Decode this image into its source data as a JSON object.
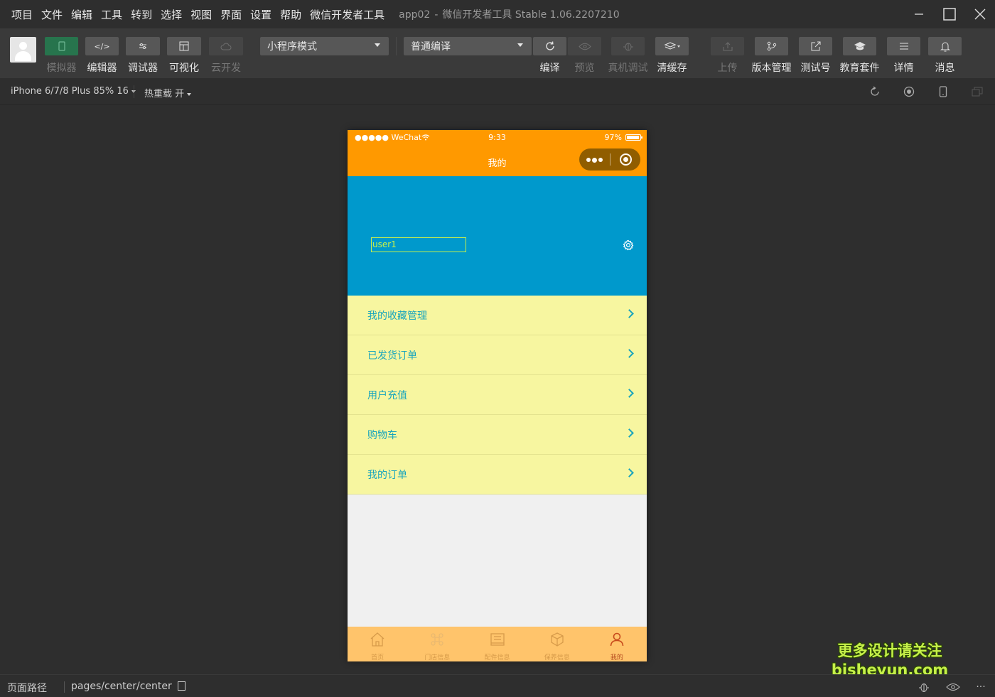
{
  "menubar": {
    "items": [
      "项目",
      "文件",
      "编辑",
      "工具",
      "转到",
      "选择",
      "视图",
      "界面",
      "设置",
      "帮助",
      "微信开发者工具"
    ],
    "project": "app02",
    "app_version": "微信开发者工具 Stable 1.06.2207210"
  },
  "toolbar": {
    "simulator": "模拟器",
    "editor": "编辑器",
    "debugger": "调试器",
    "visual": "可视化",
    "cloud": "云开发",
    "mode_select": "小程序模式",
    "compile_select": "普通编译",
    "compile": "编译",
    "preview": "预览",
    "remote_debug": "真机调试",
    "clear_cache": "清缓存",
    "upload": "上传",
    "version_mgmt": "版本管理",
    "test_account": "测试号",
    "edu_suite": "教育套件",
    "details": "详情",
    "messages": "消息"
  },
  "subbar": {
    "device": "iPhone 6/7/8 Plus 85% 16",
    "hot_reload": "热重载 开"
  },
  "phone": {
    "status": {
      "carrier": "●●●●● WeChat",
      "time": "9:33",
      "battery": "97%",
      "battery_level": 0.97
    },
    "nav_title": "我的",
    "username": "user1",
    "menu": [
      {
        "label": "我的收藏管理"
      },
      {
        "label": "已发货订单"
      },
      {
        "label": "用户充值"
      },
      {
        "label": "购物车"
      },
      {
        "label": "我的订单"
      }
    ],
    "tabs": [
      {
        "label": "首页",
        "icon": "home-icon"
      },
      {
        "label": "门店信息",
        "icon": "store-icon"
      },
      {
        "label": "配件信息",
        "icon": "parts-icon"
      },
      {
        "label": "保养信息",
        "icon": "maintenance-icon"
      },
      {
        "label": "我的",
        "icon": "user-icon",
        "active": true
      }
    ],
    "colors": {
      "header": "#ff9900",
      "profile": "#0099cc",
      "menu_bg": "#f7f6a0",
      "menu_text": "#1aa5bd",
      "tabbar": "#ffc46b"
    }
  },
  "bottombar": {
    "page_path_label": "页面路径",
    "path": "pages/center/center"
  },
  "watermark": {
    "line1": "更多设计请关注",
    "line2": "bisheyun.com"
  }
}
